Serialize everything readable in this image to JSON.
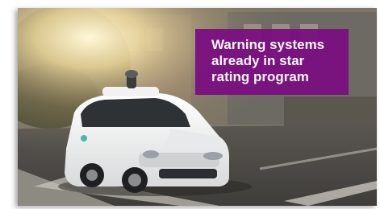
{
  "caption": {
    "lines": [
      "Warning systems",
      "already in star",
      "rating program"
    ],
    "background_color": "#7a0f80",
    "text_color": "#ffffff"
  },
  "photo": {
    "subjects": [
      "white-minivan",
      "roof-sensor",
      "houses",
      "tree",
      "street",
      "sun-glare"
    ]
  }
}
